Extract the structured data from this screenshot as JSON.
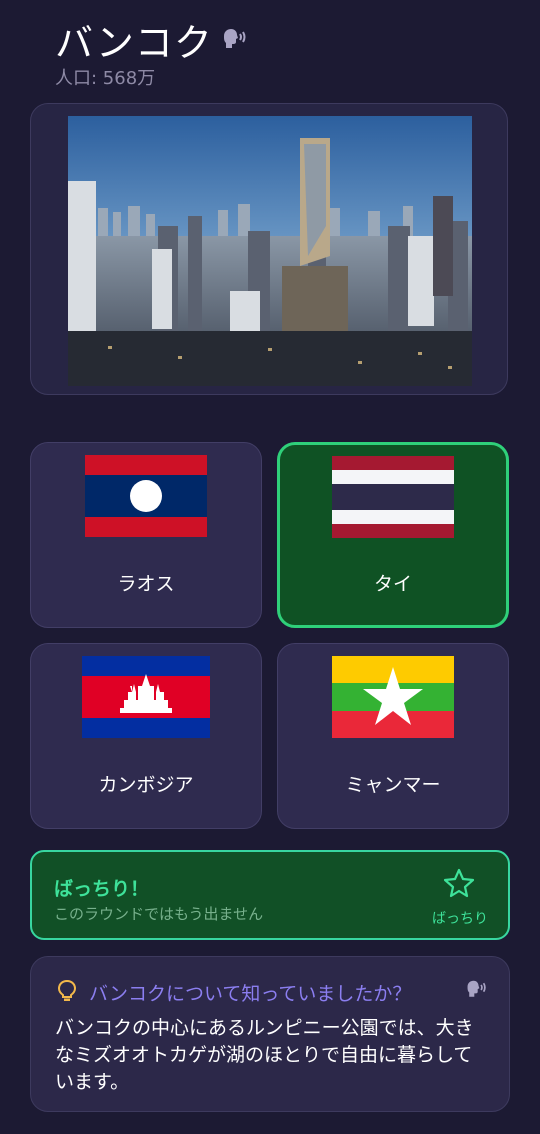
{
  "city": {
    "name": "バンコク",
    "population": "人口: 568万"
  },
  "photo": {
    "alt_icon": "city-skyline-photo"
  },
  "options": [
    {
      "label": "ラオス",
      "flag": "laos-flag",
      "state": "normal"
    },
    {
      "label": "タイ",
      "flag": "thailand-flag",
      "state": "correct"
    },
    {
      "label": "カンボジア",
      "flag": "cambodia-flag",
      "state": "normal"
    },
    {
      "label": "ミャンマー",
      "flag": "myanmar-flag",
      "state": "normal"
    }
  ],
  "feedback": {
    "title": "ばっちり！",
    "subtitle": "このラウンドではもう出ません",
    "badge": "ばっちり",
    "color": "#3ee29a"
  },
  "fact": {
    "title": "バンコクについて知っていましたか？",
    "body": "バンコクの中心にあるルンピニー公園では、大きなミズオオトカゲが湖のほとりで自由に暮らしています。"
  },
  "colors": {
    "background": "#1c1a33",
    "card": "#2f2b4f",
    "correct_bg": "#0f5224",
    "correct_border": "#2fd07a",
    "accent": "#8b7ef0"
  }
}
